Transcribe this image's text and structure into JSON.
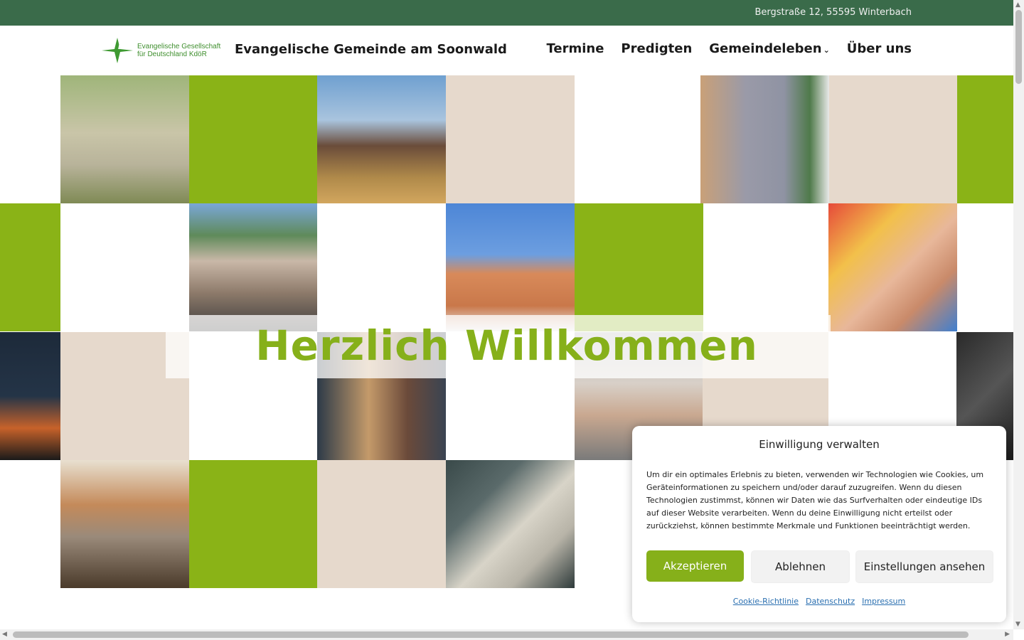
{
  "topbar": {
    "address": "Bergstraße 12, 55595 Winterbach"
  },
  "header": {
    "logo_line1": "Evangelische Gesellschaft",
    "logo_line2": "für Deutschland KdöR",
    "logo_mark": "EG",
    "site_title": "Evangelische Gemeinde am Soonwald",
    "nav": {
      "termine": "Termine",
      "predigten": "Predigten",
      "gemeindeleben": "Gemeindeleben",
      "ueber": "Über uns"
    }
  },
  "hero": {
    "welcome": "Herzlich Willkommen"
  },
  "consent": {
    "title": "Einwilligung verwalten",
    "text": "Um dir ein optimales Erlebnis zu bieten, verwenden wir Technologien wie Cookies, um Geräteinformationen zu speichern und/oder darauf zuzugreifen. Wenn du diesen Technologien zustimmst, können wir Daten wie das Surfverhalten oder eindeutige IDs auf dieser Website verarbeiten. Wenn du deine Einwilligung nicht erteilst oder zurückziehst, können bestimmte Merkmale und Funktionen beeinträchtigt werden.",
    "accept": "Akzeptieren",
    "deny": "Ablehnen",
    "settings": "Einstellungen ansehen",
    "links": {
      "cookie": "Cookie-Richtlinie",
      "privacy": "Datenschutz",
      "imprint": "Impressum"
    }
  },
  "colors": {
    "green": "#8ab317",
    "beige": "#e6d9cc",
    "topbar": "#3a6b4a"
  }
}
